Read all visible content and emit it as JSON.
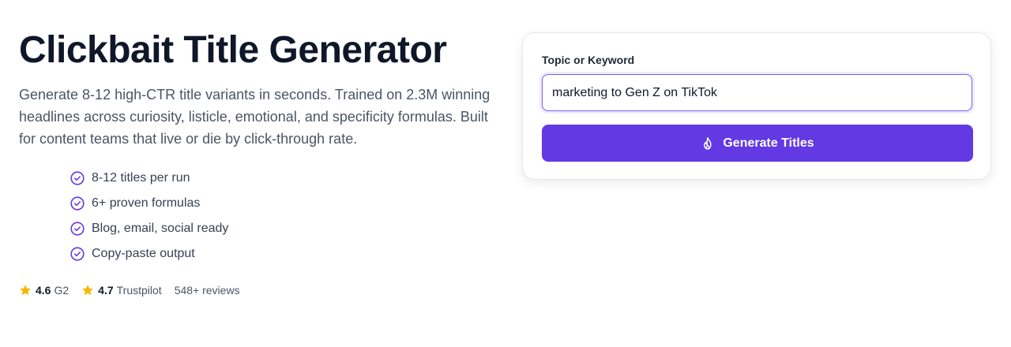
{
  "hero": {
    "title": "Clickbait Title Generator",
    "description": "Generate 8-12 high-CTR title variants in seconds. Trained on 2.3M winning headlines across curiosity, listicle, emotional, and specificity formulas. Built for content teams that live or die by click-through rate."
  },
  "features": [
    {
      "label": "8-12 titles per run",
      "icon": "check-circle-icon"
    },
    {
      "label": "6+ proven formulas",
      "icon": "check-circle-icon"
    },
    {
      "label": "Blog, email, social ready",
      "icon": "check-circle-icon"
    },
    {
      "label": "Copy-paste output",
      "icon": "check-circle-icon"
    }
  ],
  "ratings": [
    {
      "score": "4.6",
      "source": "G2",
      "icon": "star-icon"
    },
    {
      "score": "4.7",
      "source": "Trustpilot",
      "icon": "star-icon"
    }
  ],
  "reviews_count": "548+ reviews",
  "form": {
    "label": "Topic or Keyword",
    "value": "marketing to Gen Z on TikTok",
    "button_label": "Generate Titles",
    "button_icon": "flame-icon"
  },
  "colors": {
    "accent": "#6339e3",
    "star": "#f5b800",
    "title": "#0f172a",
    "text": "#4b5563"
  }
}
